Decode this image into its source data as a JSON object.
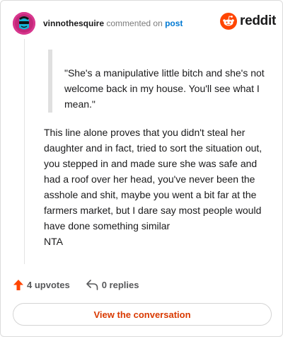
{
  "header": {
    "username": "vinnothesquire",
    "action_text": "commented on",
    "post_link": "post"
  },
  "brand": {
    "wordmark": "reddit",
    "icon": "reddit-alien-icon",
    "color": "#ff4500"
  },
  "comment": {
    "quote": "\"She's a manipulative little bitch and she's not welcome back in my house. You'll see what I mean.\"",
    "body": "This line alone proves that you didn't steal her daughter and in fact, tried to sort the situation out, you stepped in and made sure she was safe and had a roof over her head, you've never been the asshole and shit, maybe you went a bit far at the farmers market, but I dare say most people would have done something similar",
    "sign_off": "NTA"
  },
  "actions": {
    "upvotes": "4 upvotes",
    "upvote_icon": "upvote-arrow-icon",
    "replies": "0 replies",
    "reply_icon": "reply-arrow-icon"
  },
  "cta": {
    "label": "View the conversation"
  },
  "colors": {
    "accent": "#d93900",
    "link": "#0079d3",
    "avatar_bg": "#d8378e"
  }
}
